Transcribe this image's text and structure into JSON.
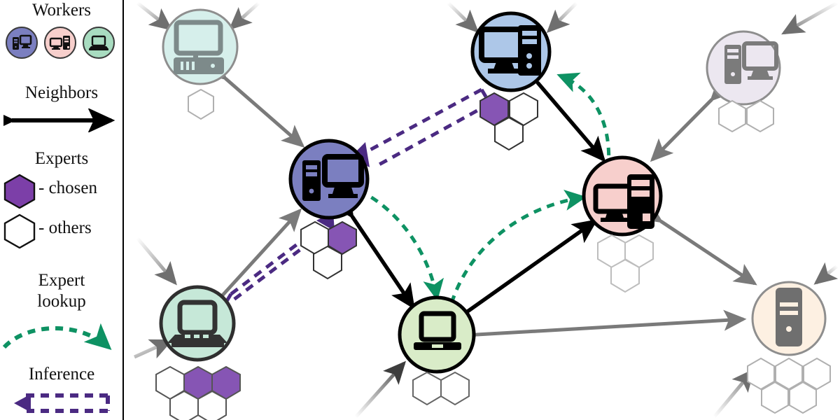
{
  "legend": {
    "workers": {
      "title": "Workers",
      "icons": [
        {
          "name": "desktop-tower-icon",
          "fill": "#7b7fc0"
        },
        {
          "name": "monitor-tower-icon",
          "fill": "#f7cfcc"
        },
        {
          "name": "laptop-icon",
          "fill": "#a8dcc0"
        }
      ]
    },
    "neighbors": {
      "title": "Neighbors",
      "arrow_name": "double-headed-arrow",
      "color": "#000000"
    },
    "experts": {
      "title": "Experts",
      "chosen_label": "- chosen",
      "others_label": "- others",
      "chosen_color": "#7c3fa8",
      "others_color": "#ffffff"
    },
    "expert_lookup": {
      "title_line1": "Expert",
      "title_line2": "lookup",
      "color": "#0e9263"
    },
    "inference": {
      "title": "Inference",
      "color": "#4b2a82"
    }
  },
  "graph": {
    "nodes": [
      {
        "id": "n-top-left",
        "icon": "desktop-computer-icon",
        "fill": "#d6efeb",
        "state": "faded",
        "hexes": {
          "row1": [
            "white"
          ],
          "row2": []
        }
      },
      {
        "id": "n-top-center",
        "icon": "monitor-tower-icon",
        "fill": "#adc7e8",
        "state": "active",
        "hexes": {
          "row1": [
            "chosen",
            "white"
          ],
          "row2": [
            "white"
          ]
        }
      },
      {
        "id": "n-top-right",
        "icon": "tower-monitor-icon",
        "fill": "#ece7f0",
        "state": "faded",
        "hexes": {
          "row1": [
            "white",
            "white"
          ],
          "row2": []
        }
      },
      {
        "id": "n-center-purple",
        "icon": "tower-monitor-icon",
        "fill": "#7b7fc0",
        "state": "active",
        "hexes": {
          "row1": [
            "white",
            "chosen"
          ],
          "row2": [
            "white"
          ]
        }
      },
      {
        "id": "n-right-pink",
        "icon": "monitor-tower-icon",
        "fill": "#f7cfcc",
        "state": "active",
        "hexes": {
          "row1": [
            "white",
            "white"
          ],
          "row2": [
            "white"
          ]
        }
      },
      {
        "id": "n-bottom-left",
        "icon": "laptop-icon",
        "fill": "#c6e8d8",
        "state": "active",
        "hexes": {
          "row1": [
            "white",
            "chosen",
            "chosen"
          ],
          "row2": [
            "white",
            "white"
          ]
        }
      },
      {
        "id": "n-bottom-center",
        "icon": "laptop-icon",
        "fill": "#d9ecc8",
        "state": "active",
        "hexes": {
          "row1": [
            "white",
            "white"
          ],
          "row2": []
        }
      },
      {
        "id": "n-bottom-right",
        "icon": "server-tower-icon",
        "fill": "#fdf0e2",
        "state": "faded",
        "hexes": {
          "row1": [
            "white",
            "white",
            "white"
          ],
          "row2": [
            "white",
            "white"
          ]
        }
      }
    ],
    "edges": {
      "neighbor_color_active": "#000000",
      "neighbor_color_faded": "#7a7a7a",
      "lookup_color": "#0e9263",
      "inference_color": "#4b2a82"
    }
  },
  "colors": {
    "chosen_hex": "#8655b4",
    "other_hex_stroke": "#555555",
    "faded_hex_stroke": "#b0b0b0",
    "divider": "#000000"
  }
}
